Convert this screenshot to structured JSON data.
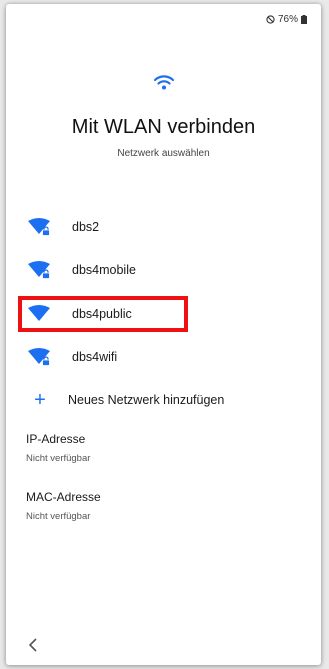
{
  "status": {
    "battery": "76%"
  },
  "header": {
    "title": "Mit WLAN verbinden",
    "subtitle": "Netzwerk auswählen"
  },
  "networks": [
    {
      "name": "dbs2",
      "secured": true
    },
    {
      "name": "dbs4mobile",
      "secured": true
    },
    {
      "name": "dbs4public",
      "secured": false
    },
    {
      "name": "dbs4wifi",
      "secured": true
    }
  ],
  "add_network": {
    "label": "Neues Netzwerk hinzufügen"
  },
  "ip": {
    "label": "IP-Adresse",
    "value": "Nicht verfügbar"
  },
  "mac": {
    "label": "MAC-Adresse",
    "value": "Nicht verfügbar"
  },
  "colors": {
    "accent": "#1d6ff2",
    "highlight": "#ee1111"
  },
  "icons": {
    "wifi": "wifi-icon",
    "lock": "lock-icon",
    "add": "plus-icon",
    "back": "chevron-left-icon"
  }
}
